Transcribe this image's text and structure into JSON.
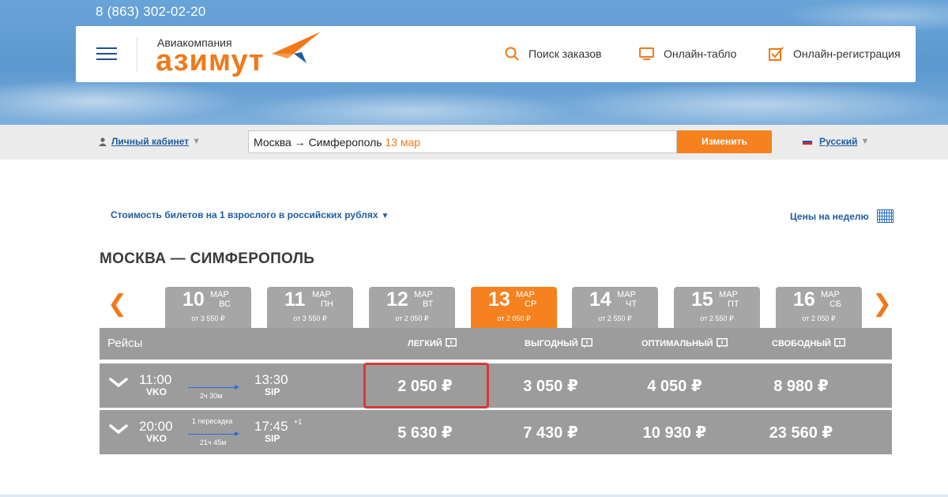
{
  "phone": "8 (863) 302-02-20",
  "logo": {
    "small": "Авиакомпания",
    "big": "азимут"
  },
  "header_nav": [
    {
      "label": "Поиск заказов",
      "icon": "search-icon"
    },
    {
      "label": "Онлайн-табло",
      "icon": "monitor-icon"
    },
    {
      "label": "Онлайн-регистрация",
      "icon": "checkbox-icon"
    }
  ],
  "cabinet": {
    "label": "Личный кабинет"
  },
  "search": {
    "route": "Москва → Симферополь",
    "date": "13 мар",
    "button": "Изменить"
  },
  "language": {
    "label": "Русский"
  },
  "price_note": "Стоимость билетов на 1 взрослого в российских рублях",
  "week_link": "Цены на неделю",
  "route_title": "МОСКВА — СИМФЕРОПОЛЬ",
  "nav_arrows": {
    "prev": "❮",
    "next": "❯"
  },
  "days": [
    {
      "num": "10",
      "mon": "МАР",
      "dow": "ВС",
      "from": "от 3 550 ₽"
    },
    {
      "num": "11",
      "mon": "МАР",
      "dow": "ПН",
      "from": "от 3 550 ₽"
    },
    {
      "num": "12",
      "mon": "МАР",
      "dow": "ВТ",
      "from": "от 2 050 ₽"
    },
    {
      "num": "13",
      "mon": "МАР",
      "dow": "СР",
      "from": "от 2 050 ₽"
    },
    {
      "num": "14",
      "mon": "МАР",
      "dow": "ЧТ",
      "from": "от 2 550 ₽"
    },
    {
      "num": "15",
      "mon": "МАР",
      "dow": "ПТ",
      "from": "от 2 550 ₽"
    },
    {
      "num": "16",
      "mon": "МАР",
      "dow": "СБ",
      "from": "от 2 050 ₽"
    }
  ],
  "active_day": "13",
  "table": {
    "flights_label": "Рейсы",
    "fares": [
      "ЛЕГКИЙ",
      "ВЫГОДНЫЙ",
      "ОПТИМАЛЬНЫЙ",
      "СВОБОДНЫЙ"
    ]
  },
  "flights": [
    {
      "dep_time": "11:00",
      "dep_ap": "VKO",
      "duration": "2ч 30м",
      "transfer": "",
      "arr_time": "13:30",
      "arr_ap": "SIP",
      "next_day": "",
      "prices": [
        "2 050 ₽",
        "3 050 ₽",
        "4 050 ₽",
        "8 980 ₽"
      ]
    },
    {
      "dep_time": "20:00",
      "dep_ap": "VKO",
      "duration": "21ч 45м",
      "transfer": "1 пересадка",
      "arr_time": "17:45",
      "arr_ap": "SIP",
      "next_day": "+1",
      "prices": [
        "5 630 ₽",
        "7 430 ₽",
        "10 930 ₽",
        "23 560 ₽"
      ]
    }
  ],
  "colors": {
    "accent": "#f5821f",
    "link": "#1f5da0",
    "row_bg": "#9c9c9c",
    "selected": "#d83838"
  }
}
